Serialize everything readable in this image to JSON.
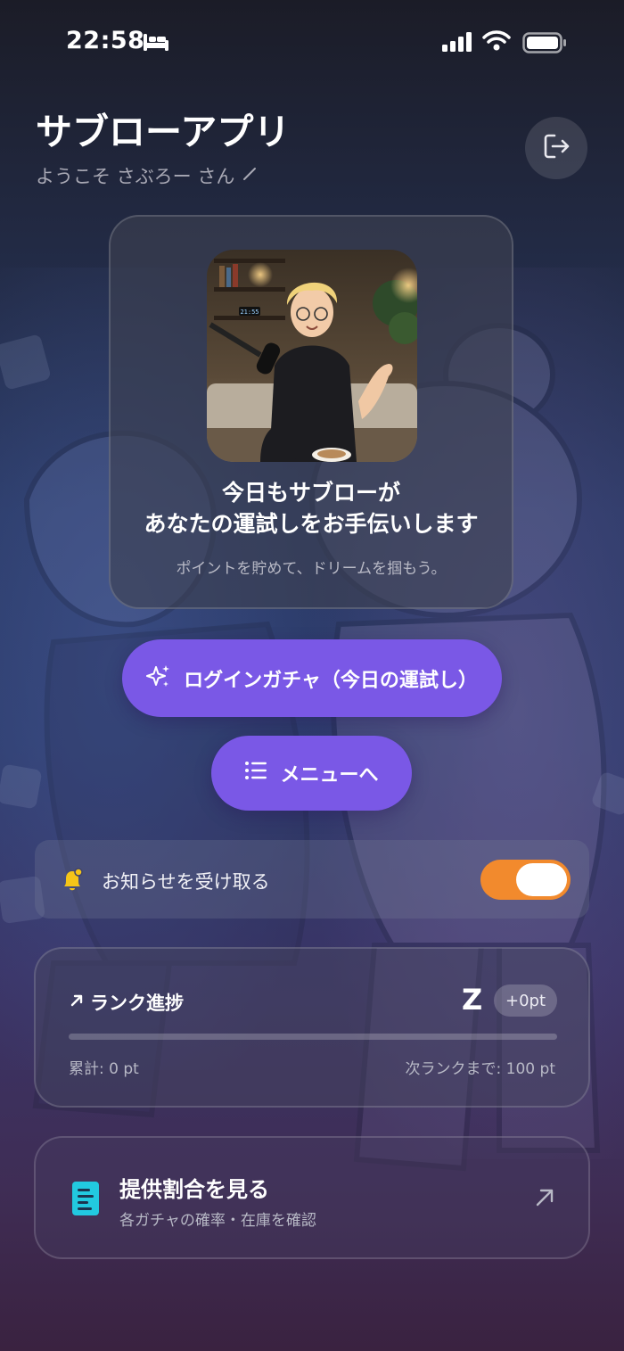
{
  "status_bar": {
    "time": "22:58",
    "icons": [
      "bed-icon",
      "cellular-signal-icon",
      "wifi-icon",
      "battery-icon"
    ]
  },
  "header": {
    "title": "サブローアプリ",
    "welcome": "ようこそ さぶろー さん",
    "edit_icon": "pencil-icon",
    "logout_icon": "logout-icon"
  },
  "hero": {
    "title_line1": "今日もサブローが",
    "title_line2": "あなたの運試しをお手伝いします",
    "subtitle": "ポイントを貯めて、ドリームを掴もう。",
    "clock_text": "21:55"
  },
  "actions": {
    "gacha_label": "ログインガチャ（今日の運試し）",
    "gacha_icon": "sparkles-icon",
    "menu_label": "メニューへ",
    "menu_icon": "list-icon"
  },
  "notifications": {
    "label": "お知らせを受け取る",
    "enabled": true,
    "icon": "bell-icon"
  },
  "rank": {
    "title": "ランク進捗",
    "icon": "arrow-up-right-icon",
    "rank_letter": "Z",
    "delta": "+0pt",
    "total": "累計: 0 pt",
    "next": "次ランクまで: 100 pt",
    "progress": 0
  },
  "rates": {
    "title": "提供割合を見る",
    "subtitle": "各ガチャの確率・在庫を確認",
    "icon": "document-icon",
    "link_icon": "arrow-up-right-icon"
  },
  "colors": {
    "primary_button": "#7a58e6",
    "toggle_on": "#f28a2d",
    "bell": "#f5c518",
    "document_icon": "#22c9e0"
  }
}
